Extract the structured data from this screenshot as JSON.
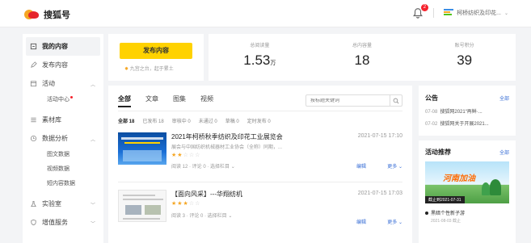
{
  "header": {
    "brand": "搜狐号",
    "notification_count": "2",
    "org_name": "柯桥纺织及印花..."
  },
  "sidebar": {
    "items": [
      {
        "label": "我的内容",
        "icon": "home-icon"
      },
      {
        "label": "发布内容",
        "icon": "pen-icon"
      },
      {
        "label": "活动",
        "icon": "calendar-icon"
      },
      {
        "label": "活动中心",
        "icon": ""
      },
      {
        "label": "素材库",
        "icon": "list-icon"
      },
      {
        "label": "数据分析",
        "icon": "clock-icon"
      },
      {
        "label": "图文数据",
        "icon": ""
      },
      {
        "label": "视频数据",
        "icon": ""
      },
      {
        "label": "短内容数据",
        "icon": ""
      },
      {
        "label": "实验室",
        "icon": "flask-icon"
      },
      {
        "label": "增值服务",
        "icon": "shield-icon"
      }
    ]
  },
  "publish": {
    "button_label": "发布内容",
    "tip": "九宫之台，起于累土"
  },
  "stats": [
    {
      "label": "总阅读量",
      "value": "1.53",
      "unit": "万"
    },
    {
      "label": "总内容量",
      "value": "18",
      "unit": ""
    },
    {
      "label": "账号积分",
      "value": "39",
      "unit": ""
    }
  ],
  "content": {
    "tabs": [
      "全部",
      "文章",
      "图集",
      "视频"
    ],
    "search_placeholder": "按标题关键词",
    "filters": [
      "全部 18",
      "已发布 18",
      "审核中 0",
      "未通过 0",
      "草稿 0",
      "定时发布 0"
    ],
    "articles": [
      {
        "title": "2021年柯桥秋季纺织及印花工业展览会",
        "date": "2021-07-15 17:10",
        "desc": "展会与中国纺织机械器材工业协会（全称）同期，...",
        "stars": 2,
        "meta": "阅读 12 · 评论 0 · 选择栏目",
        "edit": "编辑",
        "more": "更多"
      },
      {
        "title": "【面向风采】---华翔纺机",
        "date": "2021-07-15 17:03",
        "desc": "",
        "stars": 3,
        "meta": "阅读 3 · 评论 0 · 选择栏目",
        "edit": "编辑",
        "more": "更多"
      }
    ]
  },
  "notice": {
    "title": "公告",
    "all_label": "全部",
    "items": [
      {
        "date": "07-08",
        "text": "搜狐网2021“再鲜·..."
      },
      {
        "date": "07-02",
        "text": "搜狐网关于开展2021..."
      }
    ]
  },
  "activity": {
    "title": "活动推荐",
    "all_label": "全部",
    "banner_title": "河南加油",
    "banner_date": "截止到2021-07-31",
    "item_text": "黑暗个性新子游",
    "item_date": "2021-08-03 截止"
  },
  "colors": {
    "accent_yellow": "#ffd200",
    "link_blue": "#3a6fd6",
    "star": "#f5a623"
  }
}
